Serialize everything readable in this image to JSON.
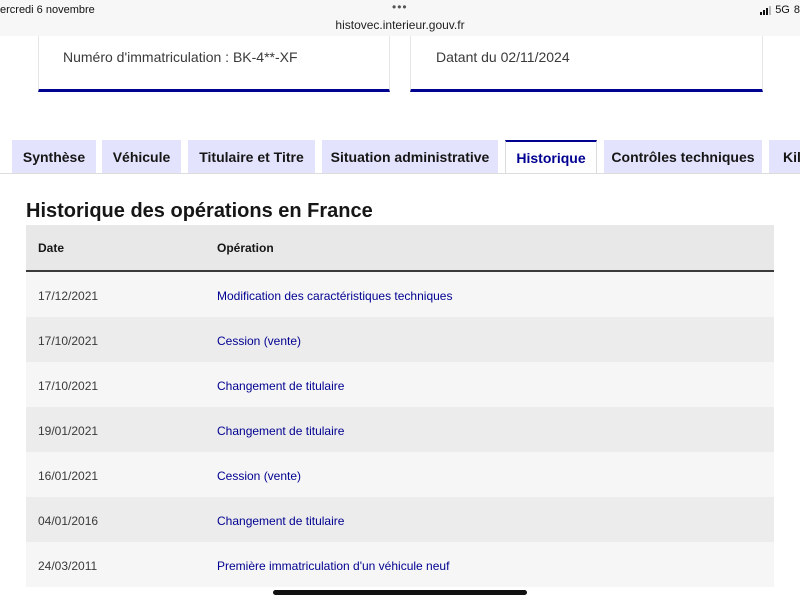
{
  "status_bar": {
    "date_text": "ercredi 6 novembre",
    "dots": "•••",
    "url": "histovec.interieur.gouv.fr",
    "network": "5G",
    "battery_partial": "8"
  },
  "cards": {
    "registration": "Numéro d'immatriculation : BK-4**-XF",
    "dated": "Datant du 02/11/2024"
  },
  "tabs": [
    {
      "label": "Synthèse",
      "active": false
    },
    {
      "label": "Véhicule",
      "active": false
    },
    {
      "label": "Titulaire et Titre",
      "active": false
    },
    {
      "label": "Situation administrative",
      "active": false
    },
    {
      "label": "Historique",
      "active": true
    },
    {
      "label": "Contrôles techniques",
      "active": false
    },
    {
      "label": "Kil",
      "active": false
    }
  ],
  "history": {
    "title": "Historique des opérations en France",
    "columns": {
      "date": "Date",
      "operation": "Opération"
    },
    "rows": [
      {
        "date": "17/12/2021",
        "operation": "Modification des caractéristiques techniques"
      },
      {
        "date": "17/10/2021",
        "operation": "Cession (vente)"
      },
      {
        "date": "17/10/2021",
        "operation": "Changement de titulaire"
      },
      {
        "date": "19/01/2021",
        "operation": "Changement de titulaire"
      },
      {
        "date": "16/01/2021",
        "operation": "Cession (vente)"
      },
      {
        "date": "04/01/2016",
        "operation": "Changement de titulaire"
      },
      {
        "date": "24/03/2011",
        "operation": "Première immatriculation d'un véhicule neuf"
      }
    ]
  },
  "colors": {
    "accent": "#000091",
    "tab_inactive": "#e3e3fd"
  }
}
